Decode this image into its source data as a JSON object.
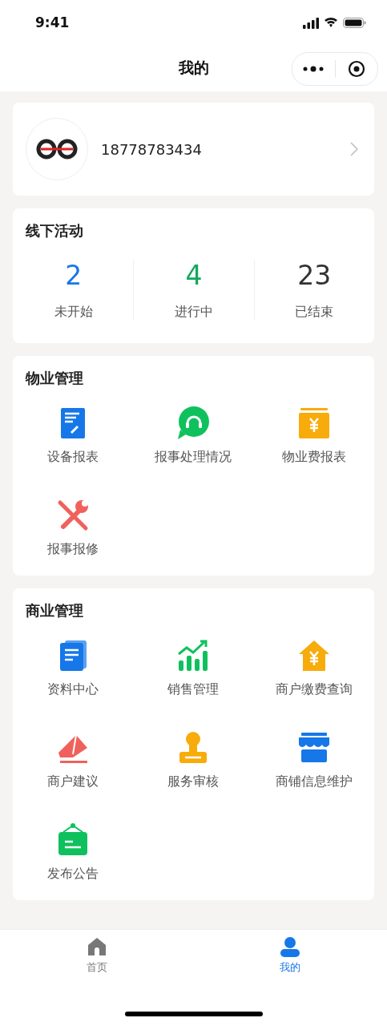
{
  "status_bar": {
    "time": "9:41"
  },
  "nav": {
    "title": "我的"
  },
  "profile": {
    "phone": "18778783434"
  },
  "activities": {
    "title": "线下活动",
    "stats": [
      {
        "value": "2",
        "label": "未开始",
        "color": "#1677e8"
      },
      {
        "value": "4",
        "label": "进行中",
        "color": "#12a85a"
      },
      {
        "value": "23",
        "label": "已结束",
        "color": "#333333"
      }
    ]
  },
  "sections": [
    {
      "title": "物业管理",
      "items": [
        {
          "kind": "report",
          "label": "设备报表"
        },
        {
          "kind": "service",
          "label": "报事处理情况"
        },
        {
          "kind": "fee",
          "label": "物业费报表"
        },
        {
          "kind": "repair",
          "label": "报事报修"
        }
      ]
    },
    {
      "title": "商业管理",
      "items": [
        {
          "kind": "docs",
          "label": "资料中心"
        },
        {
          "kind": "sales",
          "label": "销售管理"
        },
        {
          "kind": "house",
          "label": "商户缴费查询"
        },
        {
          "kind": "mail",
          "label": "商户建议"
        },
        {
          "kind": "stamp",
          "label": "服务审核"
        },
        {
          "kind": "shop",
          "label": "商铺信息维护"
        },
        {
          "kind": "notice",
          "label": "发布公告"
        }
      ]
    }
  ],
  "tabs": [
    {
      "kind": "home",
      "label": "首页",
      "selected": false
    },
    {
      "kind": "user",
      "label": "我的",
      "selected": true
    }
  ]
}
